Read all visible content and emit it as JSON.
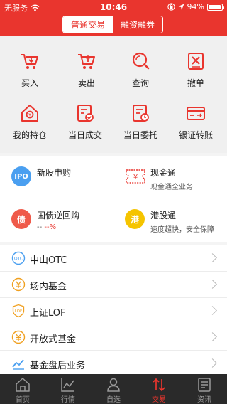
{
  "status_bar": {
    "carrier": "无服务",
    "time": "10:46",
    "battery_percent": "94%",
    "battery_level": 0.94,
    "wifi_icon": "wifi-icon",
    "lock_icon": "orientation-lock-icon",
    "location_icon": "location-icon"
  },
  "header": {
    "tabs": [
      {
        "label": "普通交易",
        "active": true
      },
      {
        "label": "融资融券",
        "active": false
      }
    ]
  },
  "colors": {
    "brand_red": "#e9352e",
    "ipo_blue": "#4a9ff0",
    "bond_red": "#ef5a4a",
    "hk_yellow": "#f5c400",
    "tabbar_bg": "#2a2a2a"
  },
  "grid": {
    "items": [
      {
        "label": "买入",
        "icon": "cart-buy-icon"
      },
      {
        "label": "卖出",
        "icon": "cart-sell-icon"
      },
      {
        "label": "查询",
        "icon": "search-icon"
      },
      {
        "label": "撤单",
        "icon": "cancel-order-icon"
      },
      {
        "label": "我的持仓",
        "icon": "house-position-icon"
      },
      {
        "label": "当日成交",
        "icon": "today-deal-icon"
      },
      {
        "label": "当日委托",
        "icon": "today-entrust-icon"
      },
      {
        "label": "银证转账",
        "icon": "bank-card-icon"
      }
    ]
  },
  "services": {
    "ipo": {
      "badge": "IPO",
      "title": "新股申购"
    },
    "cash": {
      "title": "现金通",
      "subtitle": "现金通全业务"
    },
    "repo": {
      "badge": "债",
      "title": "国债逆回购",
      "sub_dashes": "-- ",
      "sub_value": "--%"
    },
    "hk": {
      "badge": "港",
      "title": "港股通",
      "subtitle": "速度超快，安全保障"
    }
  },
  "list": {
    "items": [
      {
        "label": "中山OTC",
        "icon": "otc-icon"
      },
      {
        "label": "场内基金",
        "icon": "fund-yen-icon"
      },
      {
        "label": "上证LOF",
        "icon": "lof-shield-icon"
      },
      {
        "label": "开放式基金",
        "icon": "fund-yen-icon"
      },
      {
        "label": "基金盘后业务",
        "icon": "trend-line-icon"
      }
    ]
  },
  "tabbar": {
    "items": [
      {
        "label": "首页",
        "icon": "home-icon",
        "active": false
      },
      {
        "label": "行情",
        "icon": "chart-icon",
        "active": false
      },
      {
        "label": "自选",
        "icon": "person-icon",
        "active": false
      },
      {
        "label": "交易",
        "icon": "trade-arrows-icon",
        "active": true
      },
      {
        "label": "资讯",
        "icon": "news-icon",
        "active": false
      }
    ]
  }
}
